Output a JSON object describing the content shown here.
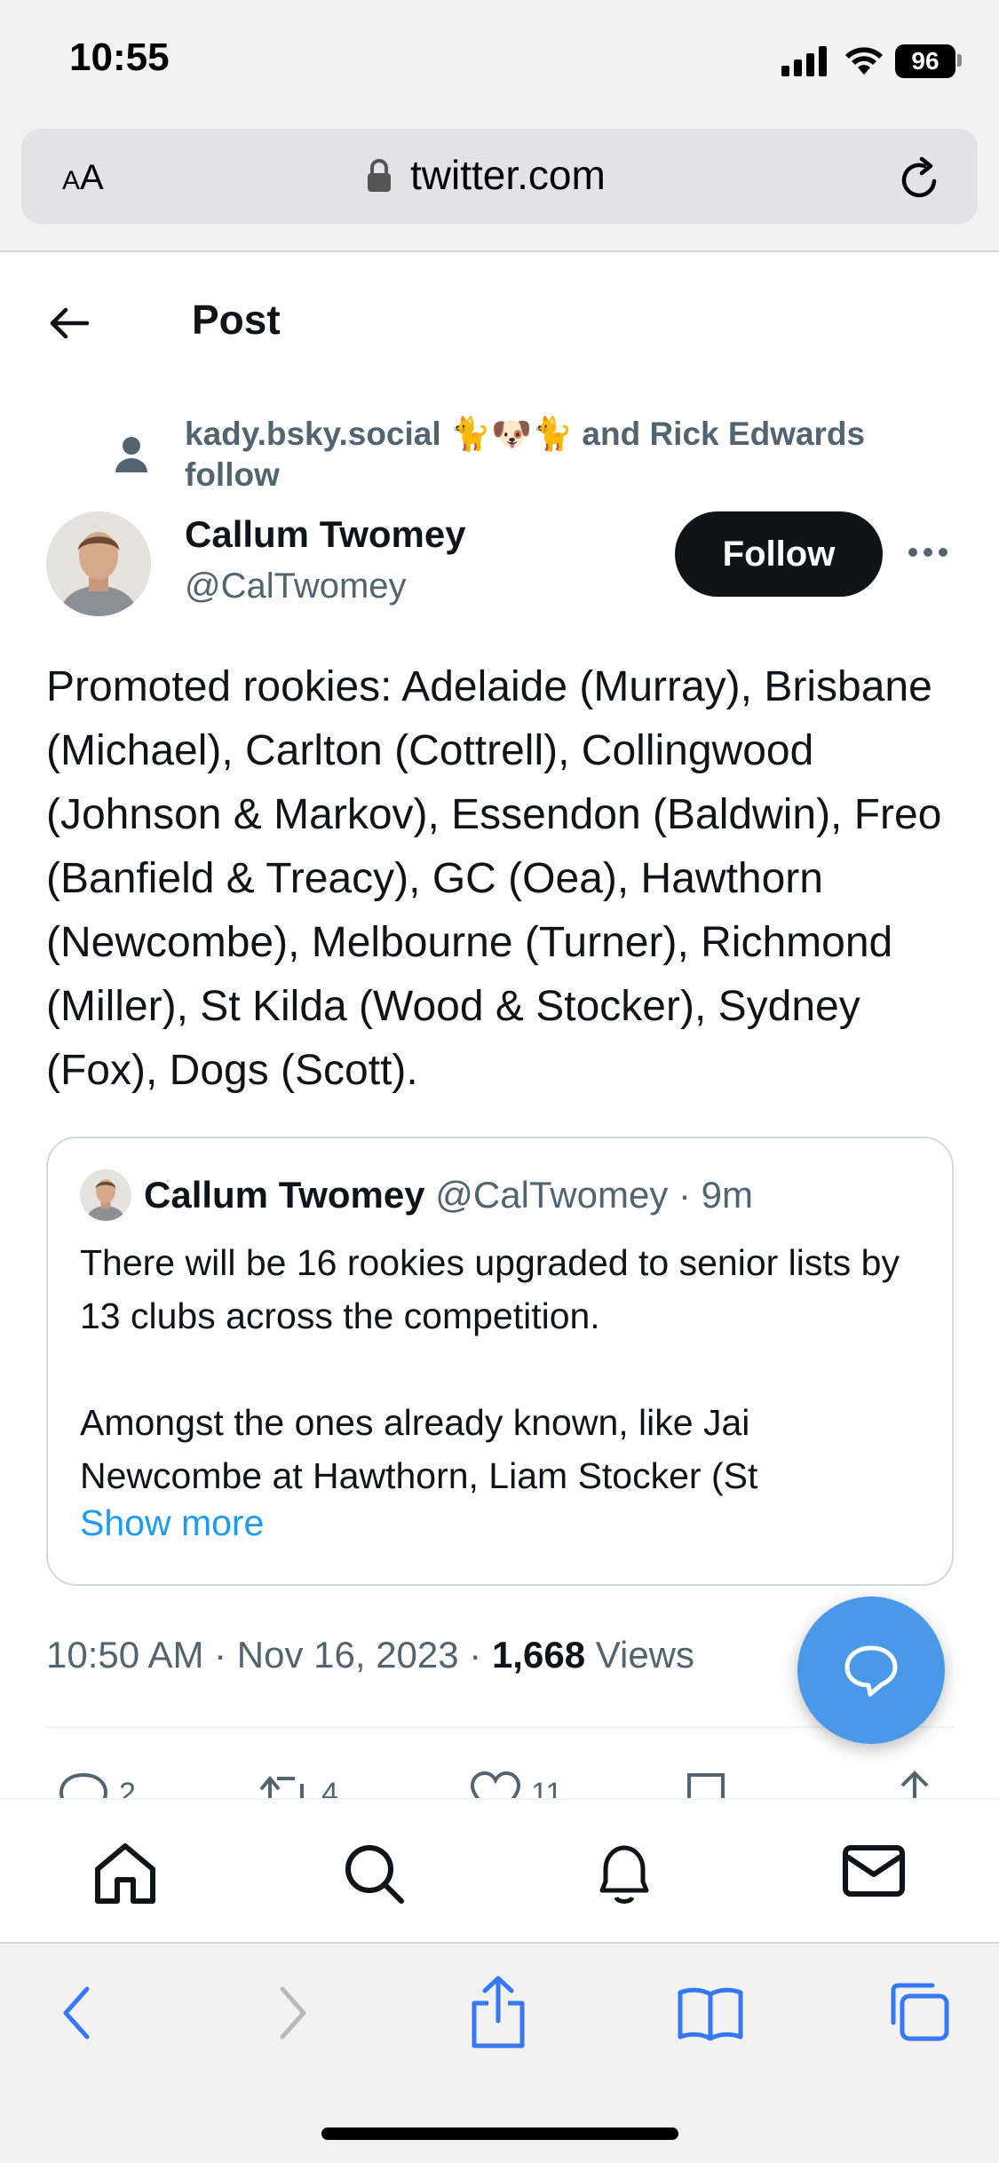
{
  "status_bar": {
    "time": "10:55",
    "battery": "96"
  },
  "browser": {
    "aa_label_small": "A",
    "aa_label_large": "A",
    "url": "twitter.com"
  },
  "header": {
    "title": "Post"
  },
  "social_context": {
    "text": "kady.bsky.social 🐈🐶🐈 and Rick Edwards follow"
  },
  "author": {
    "name": "Callum Twomey",
    "handle": "@CalTwomey",
    "follow_label": "Follow"
  },
  "tweet": {
    "text": "Promoted rookies: Adelaide (Murray), Brisbane (Michael), Carlton (Cottrell), Collingwood (Johnson & Markov), Essendon (Baldwin), Freo (Banfield & Treacy), GC (Oea), Hawthorn (Newcombe), Melbourne (Turner), Richmond (Miller), St Kilda (Wood & Stocker), Sydney (Fox), Dogs (Scott).",
    "time": "10:50 AM · Nov 16, 2023 · ",
    "views_count": "1,668",
    "views_label": " Views"
  },
  "quote": {
    "name": "Callum Twomey",
    "meta": " @CalTwomey · 9m",
    "text": "There will be 16 rookies upgraded to senior lists by 13 clubs across the competition.\n\nAmongst the ones already known, like Jai Newcombe at Hawthorn, Liam Stocker (St",
    "show_more": "Show more"
  },
  "actions": {
    "replies": "2",
    "reposts": "4",
    "likes": "11"
  },
  "icons": {
    "back": "arrow-left-icon",
    "more": "more-horizontal-icon",
    "compose": "compose-reply-icon",
    "nav": [
      "home-icon",
      "search-icon",
      "notifications-icon",
      "messages-icon"
    ],
    "toolbar": [
      "back-chevron-icon",
      "forward-chevron-icon",
      "share-icon",
      "bookmarks-icon",
      "tabs-icon"
    ]
  },
  "colors": {
    "accent": "#1d9bf0",
    "fab": "#4a99e9",
    "text": "#0f1419",
    "secondary": "#536471",
    "safari_blue": "#3478f6"
  }
}
